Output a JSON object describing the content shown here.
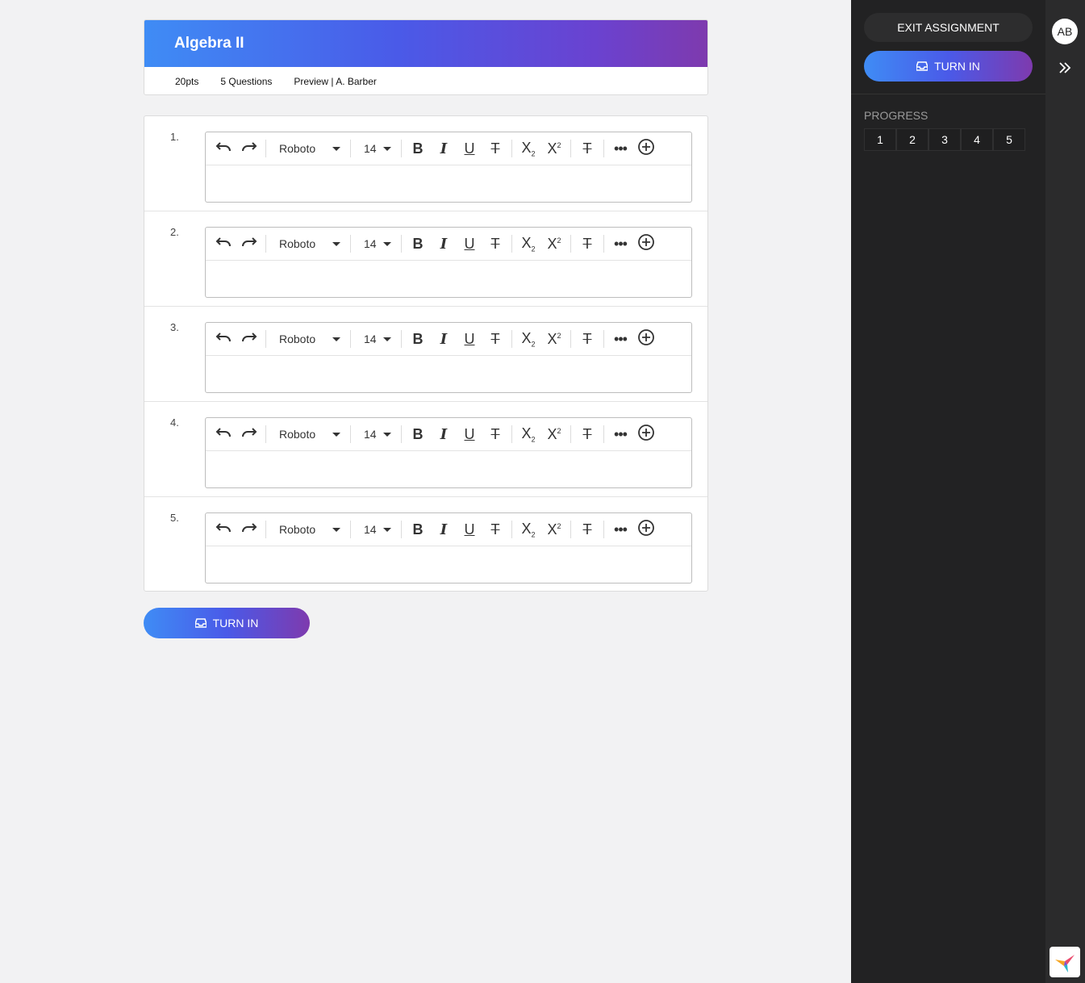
{
  "header": {
    "title": "Algebra II",
    "points": "20pts",
    "question_count": "5 Questions",
    "preview": "Preview | A. Barber"
  },
  "editor_toolbar": {
    "font": "Roboto",
    "size": "14",
    "icons": [
      "undo-icon",
      "redo-icon",
      "bold-icon",
      "italic-icon",
      "underline-icon",
      "strikethrough-icon",
      "subscript-icon",
      "superscript-icon",
      "clear-format-icon",
      "more-icon",
      "add-circle-icon"
    ]
  },
  "questions": [
    {
      "number": "1."
    },
    {
      "number": "2."
    },
    {
      "number": "3."
    },
    {
      "number": "4."
    },
    {
      "number": "5."
    }
  ],
  "main_turn_in": "TURN IN",
  "sidebar": {
    "exit_label": "EXIT ASSIGNMENT",
    "turn_in_label": "TURN IN",
    "progress_label": "PROGRESS",
    "progress_items": [
      "1",
      "2",
      "3",
      "4",
      "5"
    ]
  },
  "user": {
    "initials": "AB"
  },
  "colors": {
    "gradient_start": "#3f8cf5",
    "gradient_end": "#7e3aae",
    "sidebar_bg": "#222223"
  }
}
